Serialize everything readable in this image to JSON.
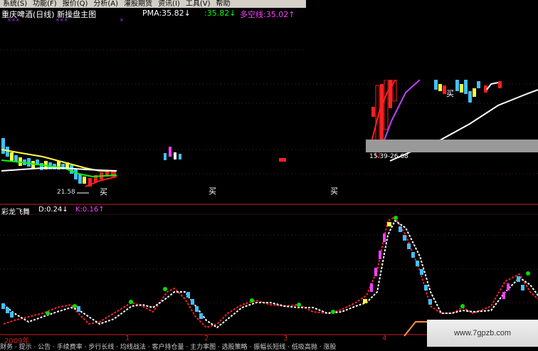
{
  "menu": [
    "系统(S)",
    "功能(F)",
    "报价(Q)",
    "分析(A)",
    "灌股期货",
    "资讯(I)",
    "工具(V)",
    "帮助"
  ],
  "main_chart": {
    "title": "重庆啤酒(日线) 新操盘主图",
    "pma": "PMA:35.82↓",
    "ma2": ":35.82↓",
    "bull_bear": "多空线:35.02↑",
    "marks_left": "×××",
    "marks_mid": "×××",
    "marks_right": "×",
    "low_label": "21.58",
    "buy_label": "买",
    "range_label": "15.39-26.68",
    "colors": {
      "pma": "#ffffff",
      "ma2": "#00ff00",
      "bull_bear": "#ff40ff",
      "red": "#ff2020",
      "cyan": "#40c0ff",
      "yellow": "#ffff40"
    }
  },
  "indicator": {
    "name": "彩龙飞舞",
    "d_value": "D:0.24↓",
    "k_value": "K:0.16↑"
  },
  "footer": {
    "year": "2009年",
    "ticks": [
      "1",
      "2",
      "3",
      "4"
    ],
    "tabs": "财务 · 提示 · 公告 · 手续费率 · 步行长线 · 均线战法 · 客户持仓量 · 主力率图 · 选股策略 · 振幅长短线 · 低吸高抛 · 涨股"
  },
  "watermark": "www.7gpzb.com"
}
